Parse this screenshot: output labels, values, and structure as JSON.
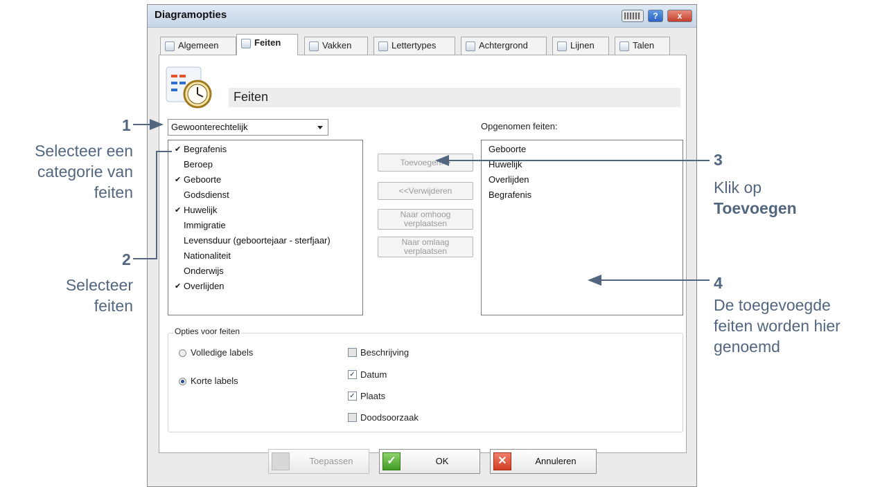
{
  "window": {
    "title": "Diagramopties",
    "help_glyph": "?",
    "close_glyph": "x"
  },
  "tabs": [
    {
      "label": "Algemeen",
      "active": false
    },
    {
      "label": "Feiten",
      "active": true
    },
    {
      "label": "Vakken",
      "active": false
    },
    {
      "label": "Lettertypes",
      "active": false
    },
    {
      "label": "Achtergrond",
      "active": false
    },
    {
      "label": "Lijnen",
      "active": false
    },
    {
      "label": "Talen",
      "active": false
    }
  ],
  "header": {
    "title": "Feiten",
    "icon": "chart-clock-icon"
  },
  "category_select": {
    "selected": "Gewoonterechtelijk"
  },
  "available_facts": [
    {
      "label": "Begrafenis",
      "checked": true
    },
    {
      "label": "Beroep",
      "checked": false
    },
    {
      "label": "Geboorte",
      "checked": true
    },
    {
      "label": "Godsdienst",
      "checked": false
    },
    {
      "label": "Huwelijk",
      "checked": true
    },
    {
      "label": "Immigratie",
      "checked": false
    },
    {
      "label": "Levensduur (geboortejaar - sterfjaar)",
      "checked": false
    },
    {
      "label": "Nationaliteit",
      "checked": false
    },
    {
      "label": "Onderwijs",
      "checked": false
    },
    {
      "label": "Overlijden",
      "checked": true
    }
  ],
  "check_glyph": "✔",
  "middle_buttons": {
    "add": "Toevoegen>>",
    "remove": "<<Verwijderen",
    "move_up_1": "Naar omhoog",
    "move_up_2": "verplaatsen",
    "move_down_1": "Naar omlaag",
    "move_down_2": "verplaatsen"
  },
  "included": {
    "label": "Opgenomen feiten:",
    "items": [
      "Geboorte",
      "Huwelijk",
      "Overlijden",
      "Begrafenis"
    ]
  },
  "options": {
    "label": "Opties voor feiten",
    "radios": [
      {
        "label": "Volledige labels",
        "selected": false
      },
      {
        "label": "Korte labels",
        "selected": true
      }
    ],
    "checkboxes": [
      {
        "label": "Beschrijving",
        "checked": false
      },
      {
        "label": "Datum",
        "checked": true
      },
      {
        "label": "Plaats",
        "checked": true
      },
      {
        "label": "Doodsoorzaak",
        "checked": false
      }
    ],
    "checkmark": "✓"
  },
  "footer": {
    "apply": "Toepassen",
    "ok": "OK",
    "cancel": "Annuleren",
    "ok_glyph": "✓",
    "cancel_glyph": "✕"
  },
  "annotations": {
    "a1": {
      "number": "1",
      "lines": [
        "Selecteer een",
        "categorie van",
        "feiten"
      ]
    },
    "a2": {
      "number": "2",
      "lines": [
        "Selecteer",
        "feiten"
      ]
    },
    "a3": {
      "number": "3",
      "line1": "Klik op",
      "bold": "Toevoegen"
    },
    "a4": {
      "number": "4",
      "lines": [
        "De toegevoegde",
        "feiten worden hier",
        "genoemd"
      ]
    }
  },
  "colors": {
    "annotation": "#53667f",
    "panel": "#ffffff",
    "window": "#ebebeb"
  }
}
